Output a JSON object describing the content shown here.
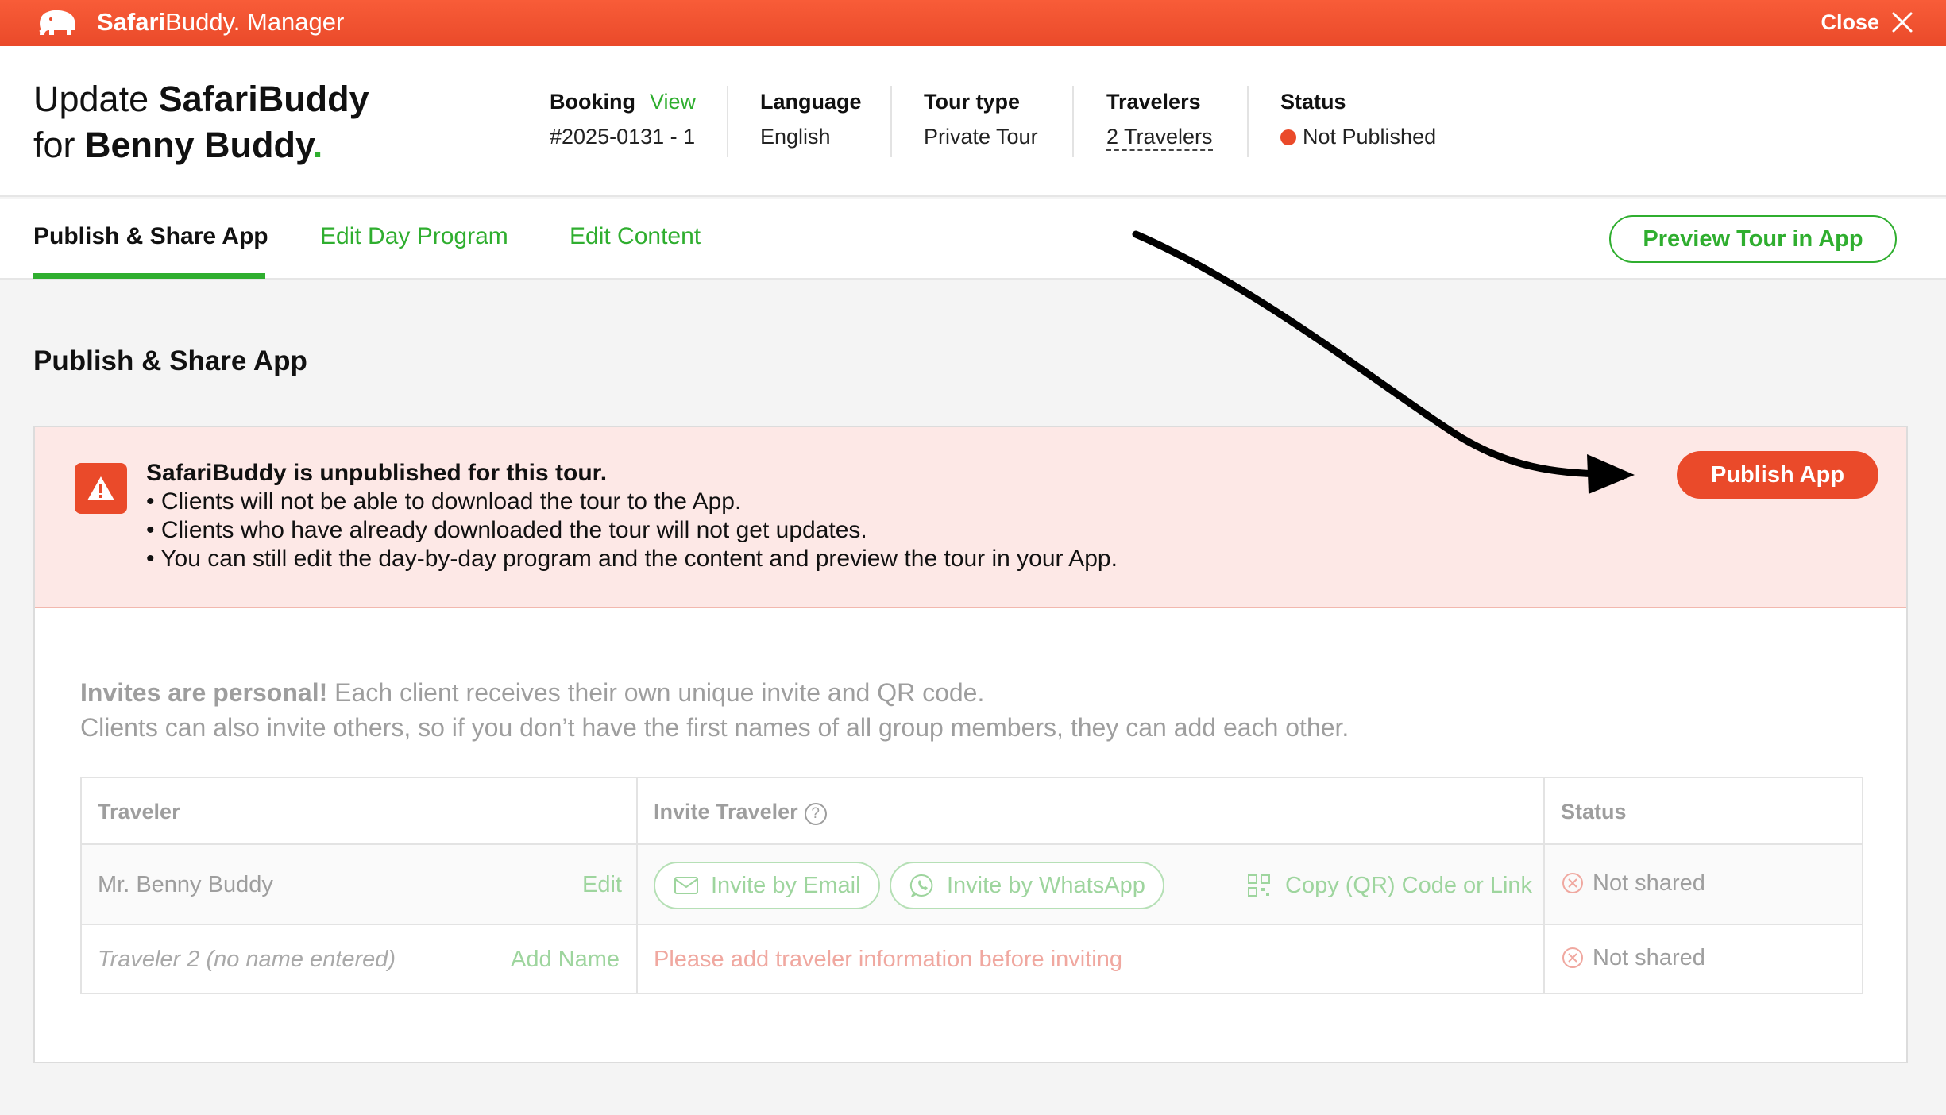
{
  "app": {
    "brand_bold": "Safari",
    "brand_rest": "Buddy. Manager",
    "close_label": "Close"
  },
  "header": {
    "title_line1_prefix": "Update ",
    "title_line1_bold": "SafariBuddy",
    "title_line2_prefix": "for ",
    "title_line2_bold": "Benny Buddy",
    "title_dot": ".",
    "booking_label": "Booking",
    "booking_link": "View",
    "booking_value": "#2025-0131 - 1",
    "language_label": "Language",
    "language_value": "English",
    "tourtype_label": "Tour type",
    "tourtype_value": "Private Tour",
    "travelers_label": "Travelers",
    "travelers_value": "2 Travelers",
    "status_label": "Status",
    "status_value": "Not Published",
    "status_color": "#ea4a2a"
  },
  "tabs": [
    {
      "label": "Publish & Share App",
      "active": true
    },
    {
      "label": "Edit Day Program",
      "active": false
    },
    {
      "label": "Edit Content",
      "active": false
    }
  ],
  "preview_button": "Preview Tour in App",
  "section_title": "Publish & Share App",
  "alert": {
    "heading": "SafariBuddy is unpublished for this tour.",
    "bullets": [
      "• Clients will not be able to download the tour to the App.",
      "• Clients who have already downloaded the tour will not get updates.",
      "• You can still edit the day-by-day program and the content and preview the tour in your App."
    ],
    "publish_button": "Publish App"
  },
  "info": {
    "bold": "Invites are personal!",
    "line1_rest": " Each client receives their own unique invite and QR code.",
    "line2": "Clients can also invite others, so if you don’t have the first names of all group members, they can add each other."
  },
  "table": {
    "headers": {
      "traveler": "Traveler",
      "invite": "Invite Traveler",
      "status": "Status",
      "help": "?"
    },
    "rows": [
      {
        "name": "Mr. Benny Buddy",
        "action": "Edit",
        "invite_email": "Invite by Email",
        "invite_whatsapp": "Invite by WhatsApp",
        "copy_link": "Copy (QR) Code or Link",
        "status": "Not shared"
      },
      {
        "name": "Traveler 2 (no name entered)",
        "action": "Add Name",
        "invite_message": "Please add traveler information before inviting",
        "status": "Not shared"
      }
    ]
  },
  "colors": {
    "brand": "#ea4a2a",
    "accent_green": "#2fae2f",
    "alert_bg": "#fde8e6"
  }
}
